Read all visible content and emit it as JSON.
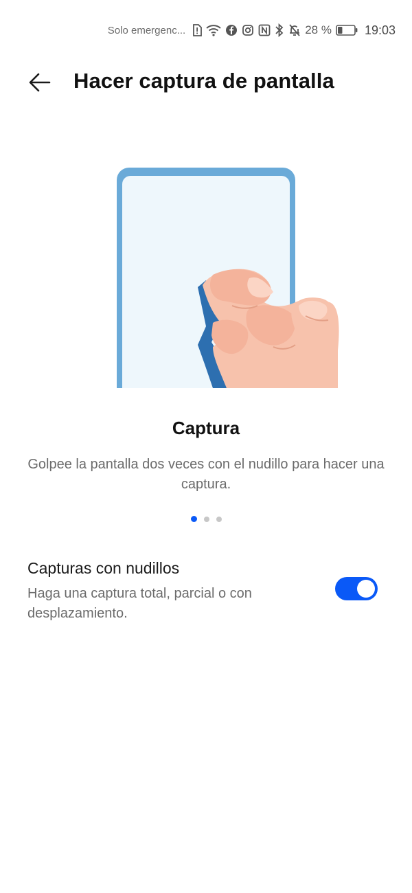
{
  "status_bar": {
    "carrier_text": "Solo emergenc...",
    "battery_percent": "28 %",
    "battery_level": 0.28,
    "time": "19:03",
    "icons": [
      "sim-alert-icon",
      "wifi-icon",
      "facebook-icon",
      "instagram-icon",
      "nfc-icon",
      "bluetooth-icon",
      "bell-off-icon",
      "battery-icon"
    ]
  },
  "header": {
    "title": "Hacer captura de pantalla",
    "back_icon": "back-arrow-icon"
  },
  "card": {
    "title": "Captura",
    "description": "Golpee la pantalla dos veces con el nudillo para hacer una captura.",
    "page_index": 0,
    "page_count": 3
  },
  "setting": {
    "title": "Capturas con nudillos",
    "description": "Haga una captura total, parcial o con desplazamiento.",
    "enabled": true
  },
  "colors": {
    "accent": "#0a59f7",
    "phone_frame": "#6aaad8",
    "phone_screen": "#eef7fc",
    "skin": "#f7c2ac"
  }
}
